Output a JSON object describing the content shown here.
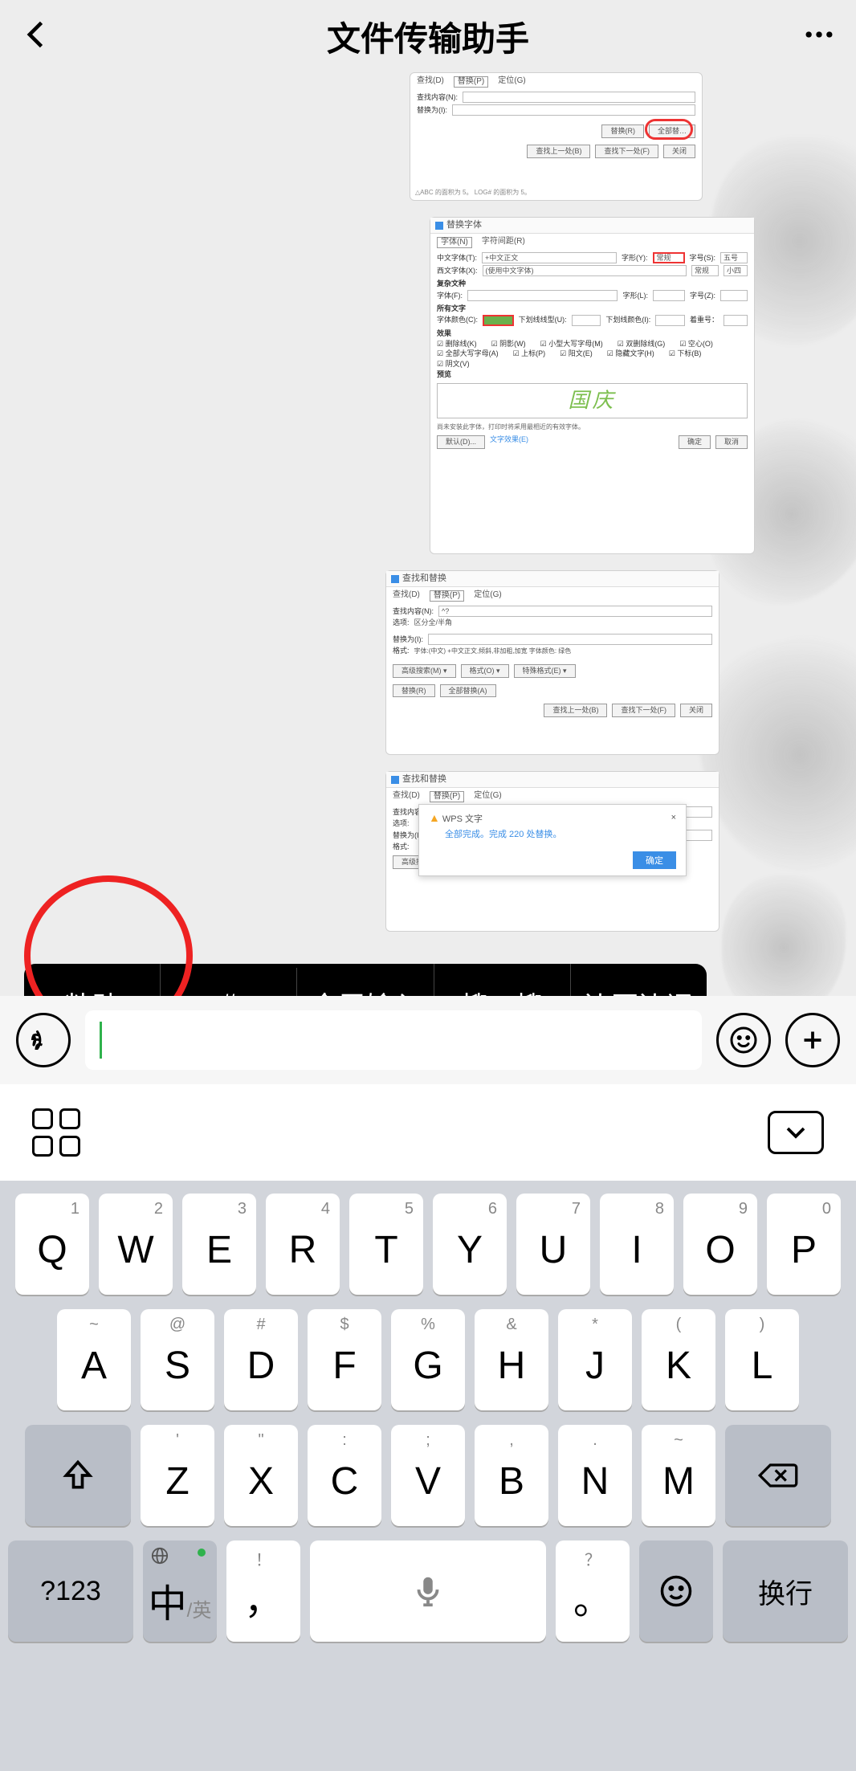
{
  "header": {
    "title": "文件传输助手"
  },
  "messages": {
    "dlg2": {
      "title": "替换字体",
      "tabs": [
        "字体(N)",
        "字符间距(R)"
      ],
      "labels": {
        "cn_font": "中文字体(T):",
        "cn_font_val": "+中文正文",
        "style": "字形(Y):",
        "style_val": "常规",
        "size": "字号(S):",
        "size_val": "五号",
        "west_font": "西文字体(X):",
        "west_val": "(使用中文字体)",
        "complex": "复杂文种",
        "font2": "字体(F):",
        "style2": "字形(L):",
        "size2": "字号(Z):",
        "effects": "所有文字",
        "color": "字体颜色(C):",
        "underline": "下划线线型(U):",
        "under_color": "下划线颜色(I):",
        "emphasis": "着重号：",
        "fx_header": "效果",
        "fx1": "删除线(K)",
        "fx2": "双删除线(G)",
        "fx3": "上标(P)",
        "fx4": "下标(B)",
        "fx5": "阴影(W)",
        "fx6": "空心(O)",
        "fx7": "阳文(E)",
        "fx8": "阴文(V)",
        "fx9": "小型大写字母(M)",
        "fx10": "全部大写字母(A)",
        "fx11": "隐藏文字(H)",
        "preview": "预览",
        "preview_text": "国庆",
        "footer_note": "尚未安装此字体，打印时将采用最相近的有效字体。",
        "btn_default": "默认(D)...",
        "btn_text_effect": "文字效果(E)",
        "btn_ok": "确定",
        "btn_cancel": "取消"
      }
    },
    "dlg3": {
      "title": "查找和替换",
      "tabs": [
        "查找(D)",
        "替换(P)",
        "定位(G)"
      ],
      "find_label": "查找内容(N):",
      "find_val": "^?",
      "options_label": "选项:",
      "options_val": "区分全/半角",
      "replace_label": "替换为(I):",
      "format_label": "格式:",
      "format_val": "字体:(中文) +中文正文,倾斜,非加粗,加宽 字体颜色: 绿色",
      "btns": {
        "adv": "高级搜索(M) ▾",
        "fmt": "格式(O) ▾",
        "special": "特殊格式(E) ▾",
        "replace": "替换(R)",
        "replace_all": "全部替换(A)",
        "find_prev": "查找上一处(B)",
        "find_next": "查找下一处(F)",
        "close": "关闭"
      }
    },
    "dlg4": {
      "title": "查找和替换",
      "tabs": [
        "查找(D)",
        "替换(P)",
        "定位(G)"
      ],
      "wps": {
        "title": "WPS 文字",
        "msg": "全部完成。完成 220 处替换。",
        "ok": "确定"
      }
    }
  },
  "popup": {
    "paste": "粘贴",
    "hash": "#",
    "fullscreen": "全屏输入",
    "search": "搜一搜",
    "translate": "边写边译"
  },
  "keyboard": {
    "r1": [
      {
        "n": "1",
        "m": "Q"
      },
      {
        "n": "2",
        "m": "W"
      },
      {
        "n": "3",
        "m": "E"
      },
      {
        "n": "4",
        "m": "R"
      },
      {
        "n": "5",
        "m": "T"
      },
      {
        "n": "6",
        "m": "Y"
      },
      {
        "n": "7",
        "m": "U"
      },
      {
        "n": "8",
        "m": "I"
      },
      {
        "n": "9",
        "m": "O"
      },
      {
        "n": "0",
        "m": "P"
      }
    ],
    "r2": [
      {
        "n": "~",
        "m": "A"
      },
      {
        "n": "@",
        "m": "S"
      },
      {
        "n": "#",
        "m": "D"
      },
      {
        "n": "$",
        "m": "F"
      },
      {
        "n": "%",
        "m": "G"
      },
      {
        "n": "&",
        "m": "H"
      },
      {
        "n": "*",
        "m": "J"
      },
      {
        "n": "(",
        "m": "K"
      },
      {
        "n": ")",
        "m": "L"
      }
    ],
    "r3": [
      {
        "n": "'",
        "m": "Z"
      },
      {
        "n": "\"",
        "m": "X"
      },
      {
        "n": ":",
        "m": "C"
      },
      {
        "n": ";",
        "m": "V"
      },
      {
        "n": ",",
        "m": "B"
      },
      {
        "n": ".",
        "m": "N"
      },
      {
        "n": "~",
        "m": "M"
      }
    ],
    "r4": {
      "mode": "?123",
      "lang_main": "中",
      "lang_sub": "/英",
      "comma": "，",
      "period_sym": "？",
      "period": "。",
      "enter": "换行"
    }
  }
}
